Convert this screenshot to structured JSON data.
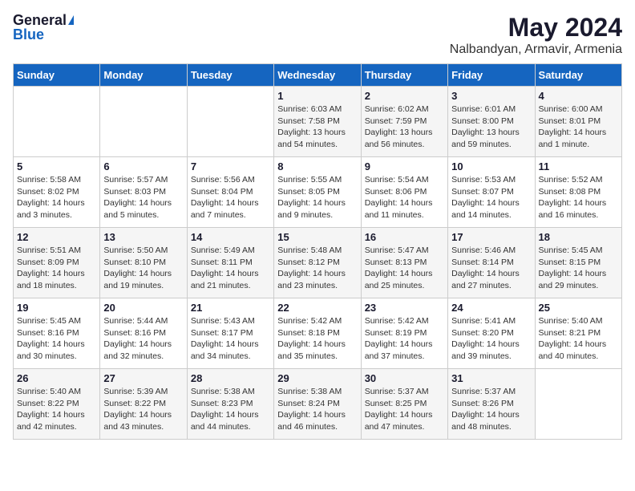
{
  "logo": {
    "general": "General",
    "blue": "Blue"
  },
  "title": "May 2024",
  "location": "Nalbandyan, Armavir, Armenia",
  "days_of_week": [
    "Sunday",
    "Monday",
    "Tuesday",
    "Wednesday",
    "Thursday",
    "Friday",
    "Saturday"
  ],
  "weeks": [
    [
      {
        "day": "",
        "info": ""
      },
      {
        "day": "",
        "info": ""
      },
      {
        "day": "",
        "info": ""
      },
      {
        "day": "1",
        "info": "Sunrise: 6:03 AM\nSunset: 7:58 PM\nDaylight: 13 hours and 54 minutes."
      },
      {
        "day": "2",
        "info": "Sunrise: 6:02 AM\nSunset: 7:59 PM\nDaylight: 13 hours and 56 minutes."
      },
      {
        "day": "3",
        "info": "Sunrise: 6:01 AM\nSunset: 8:00 PM\nDaylight: 13 hours and 59 minutes."
      },
      {
        "day": "4",
        "info": "Sunrise: 6:00 AM\nSunset: 8:01 PM\nDaylight: 14 hours and 1 minute."
      }
    ],
    [
      {
        "day": "5",
        "info": "Sunrise: 5:58 AM\nSunset: 8:02 PM\nDaylight: 14 hours and 3 minutes."
      },
      {
        "day": "6",
        "info": "Sunrise: 5:57 AM\nSunset: 8:03 PM\nDaylight: 14 hours and 5 minutes."
      },
      {
        "day": "7",
        "info": "Sunrise: 5:56 AM\nSunset: 8:04 PM\nDaylight: 14 hours and 7 minutes."
      },
      {
        "day": "8",
        "info": "Sunrise: 5:55 AM\nSunset: 8:05 PM\nDaylight: 14 hours and 9 minutes."
      },
      {
        "day": "9",
        "info": "Sunrise: 5:54 AM\nSunset: 8:06 PM\nDaylight: 14 hours and 11 minutes."
      },
      {
        "day": "10",
        "info": "Sunrise: 5:53 AM\nSunset: 8:07 PM\nDaylight: 14 hours and 14 minutes."
      },
      {
        "day": "11",
        "info": "Sunrise: 5:52 AM\nSunset: 8:08 PM\nDaylight: 14 hours and 16 minutes."
      }
    ],
    [
      {
        "day": "12",
        "info": "Sunrise: 5:51 AM\nSunset: 8:09 PM\nDaylight: 14 hours and 18 minutes."
      },
      {
        "day": "13",
        "info": "Sunrise: 5:50 AM\nSunset: 8:10 PM\nDaylight: 14 hours and 19 minutes."
      },
      {
        "day": "14",
        "info": "Sunrise: 5:49 AM\nSunset: 8:11 PM\nDaylight: 14 hours and 21 minutes."
      },
      {
        "day": "15",
        "info": "Sunrise: 5:48 AM\nSunset: 8:12 PM\nDaylight: 14 hours and 23 minutes."
      },
      {
        "day": "16",
        "info": "Sunrise: 5:47 AM\nSunset: 8:13 PM\nDaylight: 14 hours and 25 minutes."
      },
      {
        "day": "17",
        "info": "Sunrise: 5:46 AM\nSunset: 8:14 PM\nDaylight: 14 hours and 27 minutes."
      },
      {
        "day": "18",
        "info": "Sunrise: 5:45 AM\nSunset: 8:15 PM\nDaylight: 14 hours and 29 minutes."
      }
    ],
    [
      {
        "day": "19",
        "info": "Sunrise: 5:45 AM\nSunset: 8:16 PM\nDaylight: 14 hours and 30 minutes."
      },
      {
        "day": "20",
        "info": "Sunrise: 5:44 AM\nSunset: 8:16 PM\nDaylight: 14 hours and 32 minutes."
      },
      {
        "day": "21",
        "info": "Sunrise: 5:43 AM\nSunset: 8:17 PM\nDaylight: 14 hours and 34 minutes."
      },
      {
        "day": "22",
        "info": "Sunrise: 5:42 AM\nSunset: 8:18 PM\nDaylight: 14 hours and 35 minutes."
      },
      {
        "day": "23",
        "info": "Sunrise: 5:42 AM\nSunset: 8:19 PM\nDaylight: 14 hours and 37 minutes."
      },
      {
        "day": "24",
        "info": "Sunrise: 5:41 AM\nSunset: 8:20 PM\nDaylight: 14 hours and 39 minutes."
      },
      {
        "day": "25",
        "info": "Sunrise: 5:40 AM\nSunset: 8:21 PM\nDaylight: 14 hours and 40 minutes."
      }
    ],
    [
      {
        "day": "26",
        "info": "Sunrise: 5:40 AM\nSunset: 8:22 PM\nDaylight: 14 hours and 42 minutes."
      },
      {
        "day": "27",
        "info": "Sunrise: 5:39 AM\nSunset: 8:22 PM\nDaylight: 14 hours and 43 minutes."
      },
      {
        "day": "28",
        "info": "Sunrise: 5:38 AM\nSunset: 8:23 PM\nDaylight: 14 hours and 44 minutes."
      },
      {
        "day": "29",
        "info": "Sunrise: 5:38 AM\nSunset: 8:24 PM\nDaylight: 14 hours and 46 minutes."
      },
      {
        "day": "30",
        "info": "Sunrise: 5:37 AM\nSunset: 8:25 PM\nDaylight: 14 hours and 47 minutes."
      },
      {
        "day": "31",
        "info": "Sunrise: 5:37 AM\nSunset: 8:26 PM\nDaylight: 14 hours and 48 minutes."
      },
      {
        "day": "",
        "info": ""
      }
    ]
  ]
}
